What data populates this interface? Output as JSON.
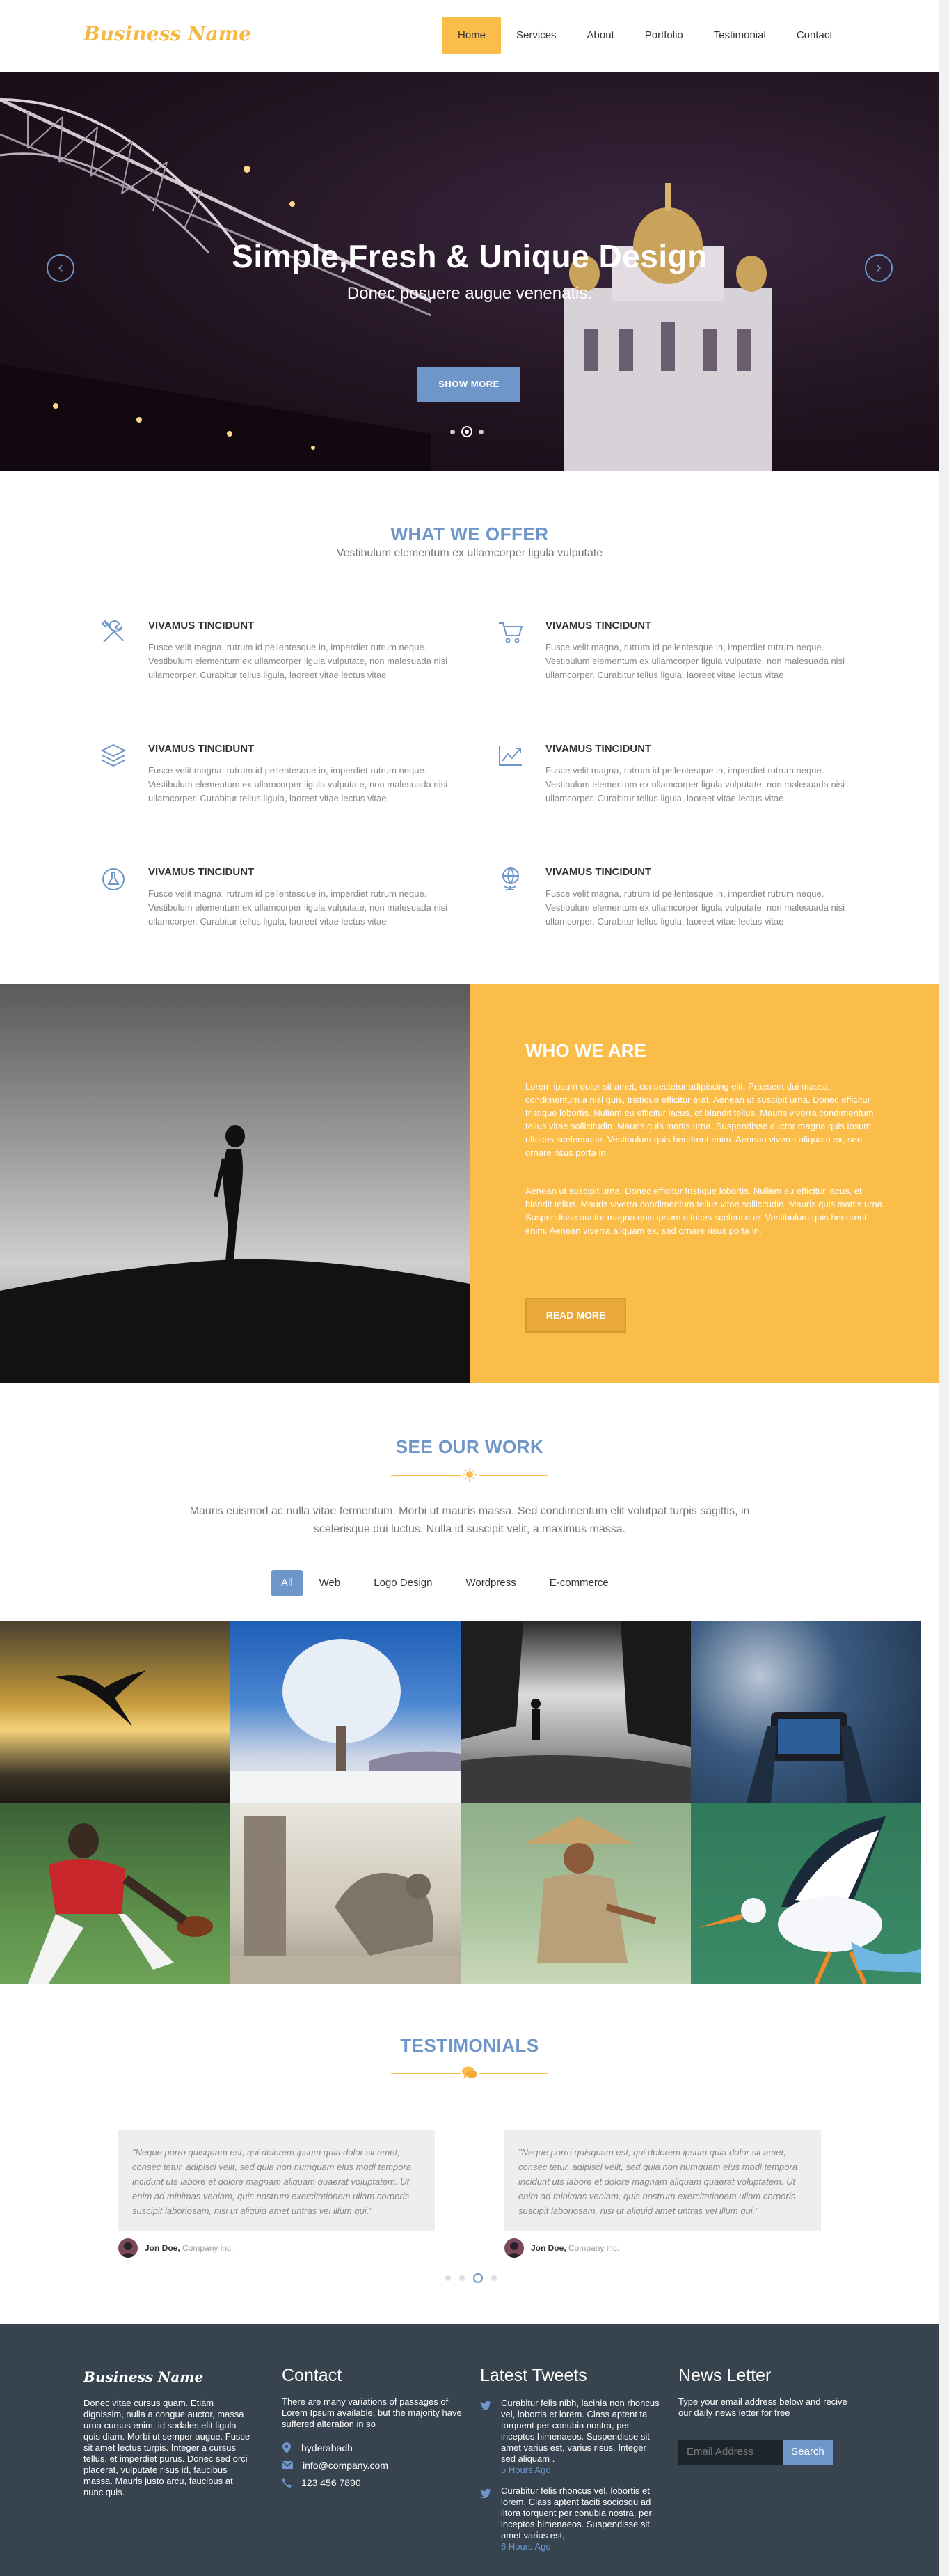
{
  "header": {
    "logo": "Business Name",
    "nav": [
      "Home",
      "Services",
      "About",
      "Portfolio",
      "Testimonial",
      "Contact"
    ],
    "active_nav": "Home"
  },
  "hero": {
    "title": "Simple,Fresh & Unique Design",
    "subtitle": "Donec posuere augue venenatis.",
    "button": "SHOW MORE",
    "prev_icon": "chevron-left-icon",
    "next_icon": "chevron-right-icon",
    "slides": 3,
    "active_slide": 2
  },
  "offer": {
    "title": "WHAT WE OFFER",
    "subtitle": "Vestibulum elementum ex ullamcorper ligula vulputate",
    "items": [
      {
        "icon": "tools-icon",
        "title": "VIVAMUS TINCIDUNT",
        "text": "Fusce velit magna, rutrum id pellentesque in, imperdiet rutrum neque. Vestibulum elementum ex ullamcorper ligula vulputate, non malesuada nisi ullamcorper. Curabitur tellus ligula, laoreet vitae lectus vitae"
      },
      {
        "icon": "cart-icon",
        "title": "VIVAMUS TINCIDUNT",
        "text": "Fusce velit magna, rutrum id pellentesque in, imperdiet rutrum neque. Vestibulum elementum ex ullamcorper ligula vulputate, non malesuada nisi ullamcorper. Curabitur tellus ligula, laoreet vitae lectus vitae"
      },
      {
        "icon": "layers-icon",
        "title": "VIVAMUS TINCIDUNT",
        "text": "Fusce velit magna, rutrum id pellentesque in, imperdiet rutrum neque. Vestibulum elementum ex ullamcorper ligula vulputate, non malesuada nisi ullamcorper. Curabitur tellus ligula, laoreet vitae lectus vitae"
      },
      {
        "icon": "chart-icon",
        "title": "VIVAMUS TINCIDUNT",
        "text": "Fusce velit magna, rutrum id pellentesque in, imperdiet rutrum neque. Vestibulum elementum ex ullamcorper ligula vulputate, non malesuada nisi ullamcorper. Curabitur tellus ligula, laoreet vitae lectus vitae"
      },
      {
        "icon": "flask-icon",
        "title": "VIVAMUS TINCIDUNT",
        "text": "Fusce velit magna, rutrum id pellentesque in, imperdiet rutrum neque. Vestibulum elementum ex ullamcorper ligula vulputate, non malesuada nisi ullamcorper. Curabitur tellus ligula, laoreet vitae lectus vitae"
      },
      {
        "icon": "globe-icon",
        "title": "VIVAMUS TINCIDUNT",
        "text": "Fusce velit magna, rutrum id pellentesque in, imperdiet rutrum neque. Vestibulum elementum ex ullamcorper ligula vulputate, non malesuada nisi ullamcorper. Curabitur tellus ligula, laoreet vitae lectus vitae"
      }
    ]
  },
  "who": {
    "title": "WHO WE ARE",
    "p1": "Lorem ipsum dolor sit amet, consectetur adipiscing elit. Praesent dui massa, condimentum a nisl quis, tristique efficitur erat. Aenean ut suscipit urna. Donec efficitur tristique lobortis. Nullam eu efficitur lacus, et blandit tellus. Mauris viverra condimentum tellus vitae sollicitudin. Mauris quis mattis urna. Suspendisse auctor magna quis ipsum ultrices scelerisque. Vestibulum quis hendrerit enim. Aenean viverra aliquam ex, sed ornare risus porta in.",
    "p2": "Aenean ut suscipit urna. Donec efficitur tristique lobortis. Nullam eu efficitur lacus, et blandit tellus. Mauris viverra condimentum tellus vitae sollicitudin. Mauris quis mattis urna. Suspendisse auctor magna quis ipsum ultrices scelerisque. Vestibulum quis hendrerit enim. Aenean viverra aliquam ex, sed ornare risus porta in.",
    "button": "READ MORE"
  },
  "work": {
    "title": "SEE OUR WORK",
    "text": "Mauris euismod ac nulla vitae fermentum. Morbi ut mauris massa. Sed condimentum elit volutpat turpis sagittis, in scelerisque dui luctus. Nulla id suscipit velit, a maximus massa.",
    "filters": [
      "All",
      "Web",
      "Logo Design",
      "Wordpress",
      "E-commerce"
    ],
    "active_filter": "All"
  },
  "testimonials": {
    "title": "TESTIMONIALS",
    "items": [
      {
        "quote": "\"Neque porro quisquam est, qui dolorem ipsum quia dolor sit amet, consec tetur, adipisci velit, sed quia non numquam eius modi tempora incidunt uts labore et dolore magnam aliquam quaerat voluptatem. Ut enim ad minimas veniam, quis nostrum exercitationem ullam corporis suscipit laboriosam, nisi ut aliquid amet untras vel illum qui.\"",
        "name": "Jon Doe,",
        "company": "Company inc."
      },
      {
        "quote": "\"Neque porro quisquam est, qui dolorem ipsum quia dolor sit amet, consec tetur, adipisci velit, sed quia non numquam eius modi tempora incidunt uts labore et dolore magnam aliquam quaerat voluptatem. Ut enim ad minimas veniam, quis nostrum exercitationem ullam corporis suscipit laboriosam, nisi ut aliquid amet untras vel illum qui.\"",
        "name": "Jon Doe,",
        "company": "Company inc."
      }
    ],
    "pages": 4,
    "active_page": 3
  },
  "footer": {
    "logo": "Business Name",
    "about": "Donec vitae cursus quam. Etiam dignissim, nulla a congue auctor, massa urna cursus enim, id sodales elit ligula quis diam. Morbi ut semper augue. Fusce sit amet lectus turpis. Integer a cursus tellus, et imperdiet purus. Donec sed orci placerat, vulputate risus id, faucibus massa. Mauris justo arcu, faucibus at nunc quis.",
    "contact_title": "Contact",
    "contact_text": "There are many variations of passages of Lorem Ipsum available, but the majority have suffered alteration in so",
    "contact_items": [
      {
        "icon": "map-pin-icon",
        "text": "hyderabadh"
      },
      {
        "icon": "envelope-icon",
        "text": "info@company.com"
      },
      {
        "icon": "phone-icon",
        "text": "123 456 7890"
      }
    ],
    "tweets_title": "Latest Tweets",
    "tweets": [
      {
        "text": "Curabitur felis nibh, lacinia non rhoncus vel, lobortis et lorem. Class aptent ta torquent per conubia nostra, per inceptos himenaeos. Suspendisse sit amet varius est, varius risus. Integer sed aliquam .",
        "time": "5 Hours Ago"
      },
      {
        "text": "Curabitur felis rhoncus vel, lobortis et lorem. Class aptent taciti sociosqu ad litora torquent per conubia nostra, per inceptos himenaeos. Suspendisse sit amet varius est,",
        "time": "6 Hours Ago"
      }
    ],
    "newsletter_title": "News Letter",
    "newsletter_text": "Type your email address below and recive our daily news letter for free",
    "email_placeholder": "Email Address",
    "search_button": "Search"
  },
  "colors": {
    "accent": "#fbbd4a",
    "blue": "#6e96c8",
    "footer": "#37444f"
  }
}
